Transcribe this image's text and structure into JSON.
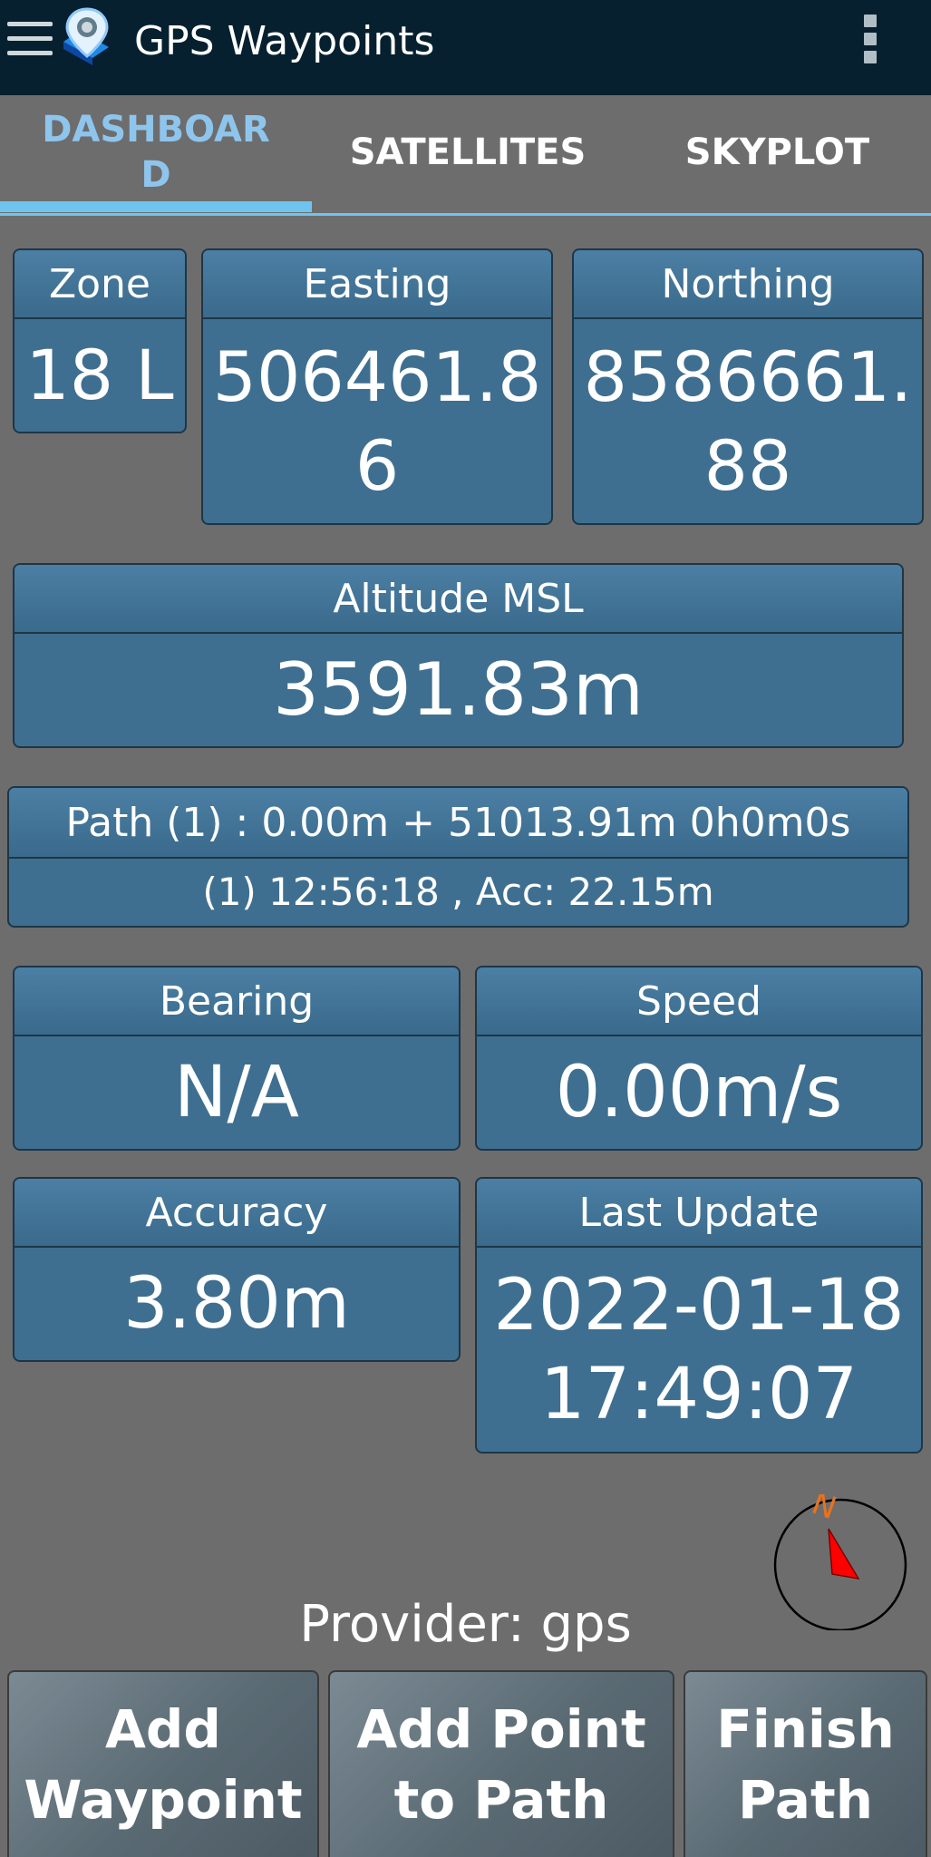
{
  "app": {
    "title": "GPS Waypoints"
  },
  "tabs": [
    {
      "label": "DASHBOAR\nD",
      "active": true
    },
    {
      "label": "SATELLITES",
      "active": false
    },
    {
      "label": "SKYPLOT",
      "active": false
    }
  ],
  "dashboard": {
    "zone": {
      "label": "Zone",
      "value": "18 L"
    },
    "easting": {
      "label": "Easting",
      "value": "506461.8 6"
    },
    "northing": {
      "label": "Northing",
      "value": "8586661. 88"
    },
    "altitude": {
      "label": "Altitude MSL",
      "value": "3591.83m"
    },
    "path": {
      "summary": "Path (1) : 0.00m + 51013.91m  0h0m0s",
      "detail": "(1) 12:56:18 , Acc: 22.15m"
    },
    "bearing": {
      "label": "Bearing",
      "value": "N/A"
    },
    "speed": {
      "label": "Speed",
      "value": "0.00m/s"
    },
    "accuracy": {
      "label": "Accuracy",
      "value": "3.80m"
    },
    "last_update": {
      "label": "Last Update",
      "value": "2022-01-18 17:49:07"
    }
  },
  "compass": {
    "north_label": "N"
  },
  "provider": "Provider: gps",
  "actions": {
    "add_waypoint": "Add\nWaypoint",
    "add_point": "Add Point\nto Path",
    "finish_path": "Finish\nPath"
  },
  "colors": {
    "appbar": "#06202f",
    "background": "#6d6d6d",
    "card": "#3f6f90",
    "tab_accent": "#6ec4ee",
    "compass_needle": "#ff0000",
    "compass_north": "#e8731d"
  }
}
